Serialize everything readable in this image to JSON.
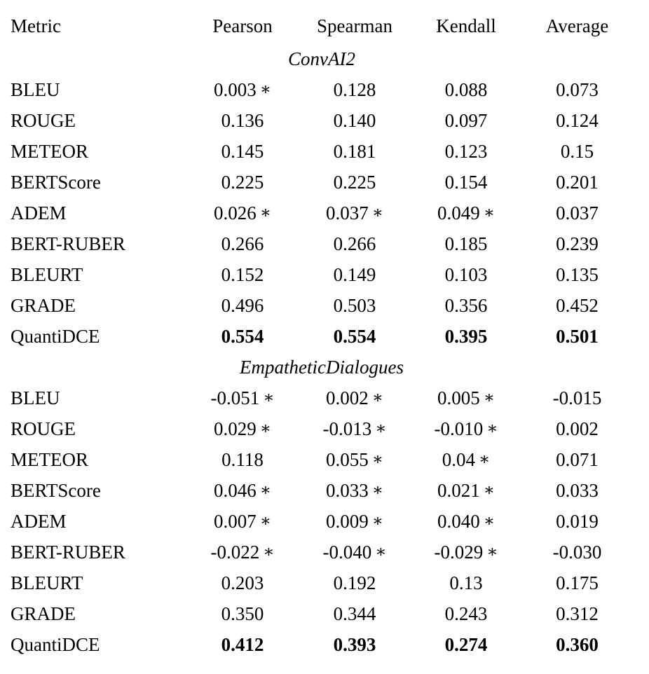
{
  "table": {
    "columns": [
      "Metric",
      "Pearson",
      "Spearman",
      "Kendall",
      "Average"
    ],
    "significance_marker": "*",
    "sections": [
      {
        "title": "ConvAI2",
        "groups": [
          {
            "rows": [
              {
                "metric": "BLEU",
                "pearson": "0.003",
                "pearson_star": "*",
                "spearman": "0.128",
                "spearman_star": "",
                "kendall": "0.088",
                "kendall_star": "",
                "average": "0.073",
                "bold": false
              },
              {
                "metric": "ROUGE",
                "pearson": "0.136",
                "pearson_star": "",
                "spearman": "0.140",
                "spearman_star": "",
                "kendall": "0.097",
                "kendall_star": "",
                "average": "0.124",
                "bold": false
              },
              {
                "metric": "METEOR",
                "pearson": "0.145",
                "pearson_star": "",
                "spearman": "0.181",
                "spearman_star": "",
                "kendall": "0.123",
                "kendall_star": "",
                "average": "0.15",
                "bold": false
              },
              {
                "metric": "BERTScore",
                "pearson": "0.225",
                "pearson_star": "",
                "spearman": "0.225",
                "spearman_star": "",
                "kendall": "0.154",
                "kendall_star": "",
                "average": "0.201",
                "bold": false
              }
            ]
          },
          {
            "rows": [
              {
                "metric": "ADEM",
                "pearson": "0.026",
                "pearson_star": "*",
                "spearman": "0.037",
                "spearman_star": "*",
                "kendall": "0.049",
                "kendall_star": "*",
                "average": "0.037",
                "bold": false
              },
              {
                "metric": "BERT-RUBER",
                "pearson": "0.266",
                "pearson_star": "",
                "spearman": "0.266",
                "spearman_star": "",
                "kendall": "0.185",
                "kendall_star": "",
                "average": "0.239",
                "bold": false
              },
              {
                "metric": "BLEURT",
                "pearson": "0.152",
                "pearson_star": "",
                "spearman": "0.149",
                "spearman_star": "",
                "kendall": "0.103",
                "kendall_star": "",
                "average": "0.135",
                "bold": false
              },
              {
                "metric": "GRADE",
                "pearson": "0.496",
                "pearson_star": "",
                "spearman": "0.503",
                "spearman_star": "",
                "kendall": "0.356",
                "kendall_star": "",
                "average": "0.452",
                "bold": false
              }
            ]
          },
          {
            "rows": [
              {
                "metric": "QuantiDCE",
                "pearson": "0.554",
                "pearson_star": "",
                "spearman": "0.554",
                "spearman_star": "",
                "kendall": "0.395",
                "kendall_star": "",
                "average": "0.501",
                "bold": true
              }
            ]
          }
        ]
      },
      {
        "title": "EmpatheticDialogues",
        "groups": [
          {
            "rows": [
              {
                "metric": "BLEU",
                "pearson": "-0.051",
                "pearson_star": "*",
                "spearman": "0.002",
                "spearman_star": "*",
                "kendall": "0.005",
                "kendall_star": "*",
                "average": "-0.015",
                "bold": false
              },
              {
                "metric": "ROUGE",
                "pearson": "0.029",
                "pearson_star": "*",
                "spearman": "-0.013",
                "spearman_star": "*",
                "kendall": "-0.010",
                "kendall_star": "*",
                "average": "0.002",
                "bold": false
              },
              {
                "metric": "METEOR",
                "pearson": "0.118",
                "pearson_star": "",
                "spearman": "0.055",
                "spearman_star": "*",
                "kendall": "0.04",
                "kendall_star": "*",
                "average": "0.071",
                "bold": false
              },
              {
                "metric": "BERTScore",
                "pearson": "0.046",
                "pearson_star": "*",
                "spearman": "0.033",
                "spearman_star": "*",
                "kendall": "0.021",
                "kendall_star": "*",
                "average": "0.033",
                "bold": false
              }
            ]
          },
          {
            "rows": [
              {
                "metric": "ADEM",
                "pearson": "0.007",
                "pearson_star": "*",
                "spearman": "0.009",
                "spearman_star": "*",
                "kendall": "0.040",
                "kendall_star": "*",
                "average": "0.019",
                "bold": false
              },
              {
                "metric": "BERT-RUBER",
                "pearson": "-0.022",
                "pearson_star": "*",
                "spearman": "-0.040",
                "spearman_star": "*",
                "kendall": "-0.029",
                "kendall_star": "*",
                "average": "-0.030",
                "bold": false
              },
              {
                "metric": "BLEURT",
                "pearson": "0.203",
                "pearson_star": "",
                "spearman": "0.192",
                "spearman_star": "",
                "kendall": "0.13",
                "kendall_star": "",
                "average": "0.175",
                "bold": false
              },
              {
                "metric": "GRADE",
                "pearson": "0.350",
                "pearson_star": "",
                "spearman": "0.344",
                "spearman_star": "",
                "kendall": "0.243",
                "kendall_star": "",
                "average": "0.312",
                "bold": false
              }
            ]
          },
          {
            "rows": [
              {
                "metric": "QuantiDCE",
                "pearson": "0.412",
                "pearson_star": "",
                "spearman": "0.393",
                "spearman_star": "",
                "kendall": "0.274",
                "kendall_star": "",
                "average": "0.360",
                "bold": true
              }
            ]
          }
        ]
      }
    ]
  },
  "chart_data": {
    "type": "table",
    "title": "",
    "columns": [
      "Metric",
      "Pearson",
      "Spearman",
      "Kendall",
      "Average"
    ],
    "datasets": [
      "ConvAI2",
      "EmpatheticDialogues"
    ],
    "rows": [
      {
        "dataset": "ConvAI2",
        "metric": "BLEU",
        "Pearson": 0.003,
        "Spearman": 0.128,
        "Kendall": 0.088,
        "Average": 0.073,
        "not_significant": [
          "Pearson"
        ]
      },
      {
        "dataset": "ConvAI2",
        "metric": "ROUGE",
        "Pearson": 0.136,
        "Spearman": 0.14,
        "Kendall": 0.097,
        "Average": 0.124,
        "not_significant": []
      },
      {
        "dataset": "ConvAI2",
        "metric": "METEOR",
        "Pearson": 0.145,
        "Spearman": 0.181,
        "Kendall": 0.123,
        "Average": 0.15,
        "not_significant": []
      },
      {
        "dataset": "ConvAI2",
        "metric": "BERTScore",
        "Pearson": 0.225,
        "Spearman": 0.225,
        "Kendall": 0.154,
        "Average": 0.201,
        "not_significant": []
      },
      {
        "dataset": "ConvAI2",
        "metric": "ADEM",
        "Pearson": 0.026,
        "Spearman": 0.037,
        "Kendall": 0.049,
        "Average": 0.037,
        "not_significant": [
          "Pearson",
          "Spearman",
          "Kendall"
        ]
      },
      {
        "dataset": "ConvAI2",
        "metric": "BERT-RUBER",
        "Pearson": 0.266,
        "Spearman": 0.266,
        "Kendall": 0.185,
        "Average": 0.239,
        "not_significant": []
      },
      {
        "dataset": "ConvAI2",
        "metric": "BLEURT",
        "Pearson": 0.152,
        "Spearman": 0.149,
        "Kendall": 0.103,
        "Average": 0.135,
        "not_significant": []
      },
      {
        "dataset": "ConvAI2",
        "metric": "GRADE",
        "Pearson": 0.496,
        "Spearman": 0.503,
        "Kendall": 0.356,
        "Average": 0.452,
        "not_significant": []
      },
      {
        "dataset": "ConvAI2",
        "metric": "QuantiDCE",
        "Pearson": 0.554,
        "Spearman": 0.554,
        "Kendall": 0.395,
        "Average": 0.501,
        "not_significant": [],
        "bold": true
      },
      {
        "dataset": "EmpatheticDialogues",
        "metric": "BLEU",
        "Pearson": -0.051,
        "Spearman": 0.002,
        "Kendall": 0.005,
        "Average": -0.015,
        "not_significant": [
          "Pearson",
          "Spearman",
          "Kendall"
        ]
      },
      {
        "dataset": "EmpatheticDialogues",
        "metric": "ROUGE",
        "Pearson": 0.029,
        "Spearman": -0.013,
        "Kendall": -0.01,
        "Average": 0.002,
        "not_significant": [
          "Pearson",
          "Spearman",
          "Kendall"
        ]
      },
      {
        "dataset": "EmpatheticDialogues",
        "metric": "METEOR",
        "Pearson": 0.118,
        "Spearman": 0.055,
        "Kendall": 0.04,
        "Average": 0.071,
        "not_significant": [
          "Spearman",
          "Kendall"
        ]
      },
      {
        "dataset": "EmpatheticDialogues",
        "metric": "BERTScore",
        "Pearson": 0.046,
        "Spearman": 0.033,
        "Kendall": 0.021,
        "Average": 0.033,
        "not_significant": [
          "Pearson",
          "Spearman",
          "Kendall"
        ]
      },
      {
        "dataset": "EmpatheticDialogues",
        "metric": "ADEM",
        "Pearson": 0.007,
        "Spearman": 0.009,
        "Kendall": 0.04,
        "Average": 0.019,
        "not_significant": [
          "Pearson",
          "Spearman",
          "Kendall"
        ]
      },
      {
        "dataset": "EmpatheticDialogues",
        "metric": "BERT-RUBER",
        "Pearson": -0.022,
        "Spearman": -0.04,
        "Kendall": -0.029,
        "Average": -0.03,
        "not_significant": [
          "Pearson",
          "Spearman",
          "Kendall"
        ]
      },
      {
        "dataset": "EmpatheticDialogues",
        "metric": "BLEURT",
        "Pearson": 0.203,
        "Spearman": 0.192,
        "Kendall": 0.13,
        "Average": 0.175,
        "not_significant": []
      },
      {
        "dataset": "EmpatheticDialogues",
        "metric": "GRADE",
        "Pearson": 0.35,
        "Spearman": 0.344,
        "Kendall": 0.243,
        "Average": 0.312,
        "not_significant": []
      },
      {
        "dataset": "EmpatheticDialogues",
        "metric": "QuantiDCE",
        "Pearson": 0.412,
        "Spearman": 0.393,
        "Kendall": 0.274,
        "Average": 0.36,
        "not_significant": [],
        "bold": true
      }
    ]
  }
}
